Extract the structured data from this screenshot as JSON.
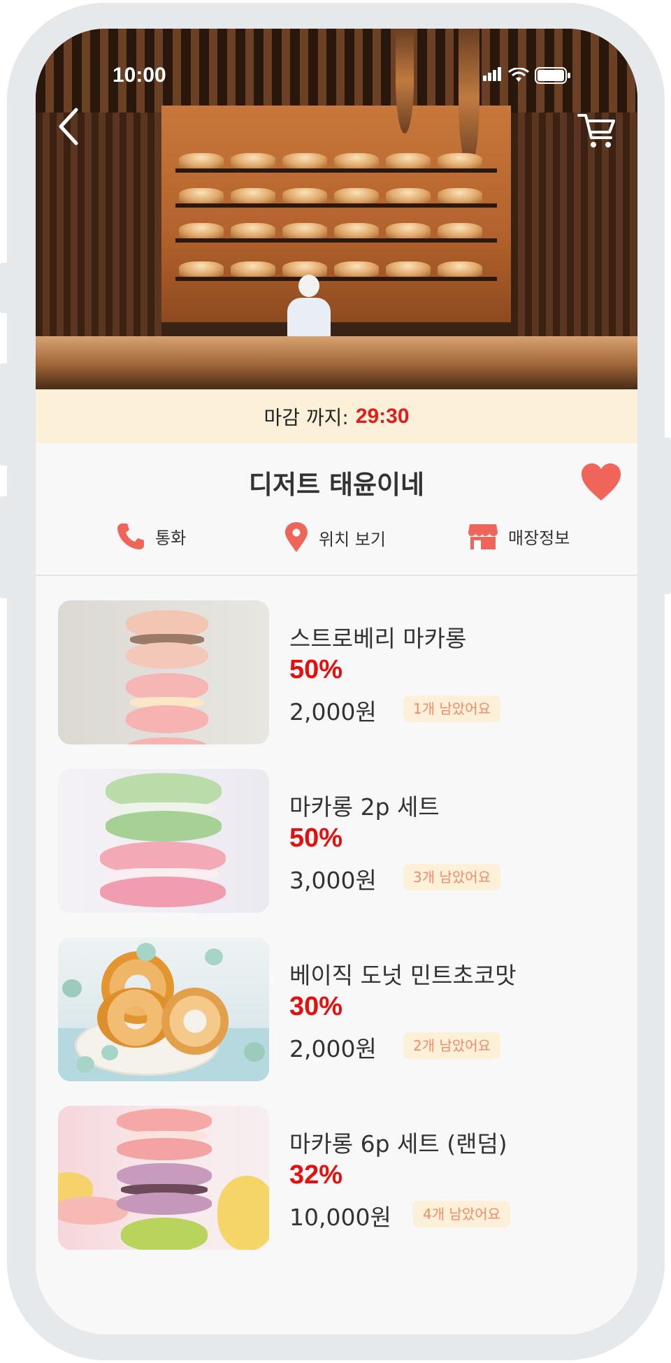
{
  "status_bar": {
    "time": "10:00"
  },
  "header": {
    "back_icon": "chevron-left-icon",
    "cart_icon": "cart-icon"
  },
  "deadline": {
    "label": "마감 까지:",
    "time": "29:30",
    "time_color": "#e11d1d",
    "banner_bg": "#fdf0d8"
  },
  "store": {
    "name": "디저트 태윤이네",
    "favorite": true,
    "heart_color": "#f0655a"
  },
  "actions": [
    {
      "label": "통화",
      "icon": "phone-icon"
    },
    {
      "label": "위치 보기",
      "icon": "location-pin-icon"
    },
    {
      "label": "매장정보",
      "icon": "store-icon"
    }
  ],
  "accent_color": "#f0655a",
  "products": [
    {
      "name": "스트로베리 마카롱",
      "discount": "50%",
      "price": "2,000원",
      "stock": "1개 남았어요"
    },
    {
      "name": "마카롱 2p 세트",
      "discount": "50%",
      "price": "3,000원",
      "stock": "3개 남았어요"
    },
    {
      "name": "베이직 도넛 민트초코맛",
      "discount": "30%",
      "price": "2,000원",
      "stock": "2개 남았어요"
    },
    {
      "name": "마카롱 6p 세트 (랜덤)",
      "discount": "32%",
      "price": "10,000원",
      "stock": "4개 남았어요"
    }
  ]
}
